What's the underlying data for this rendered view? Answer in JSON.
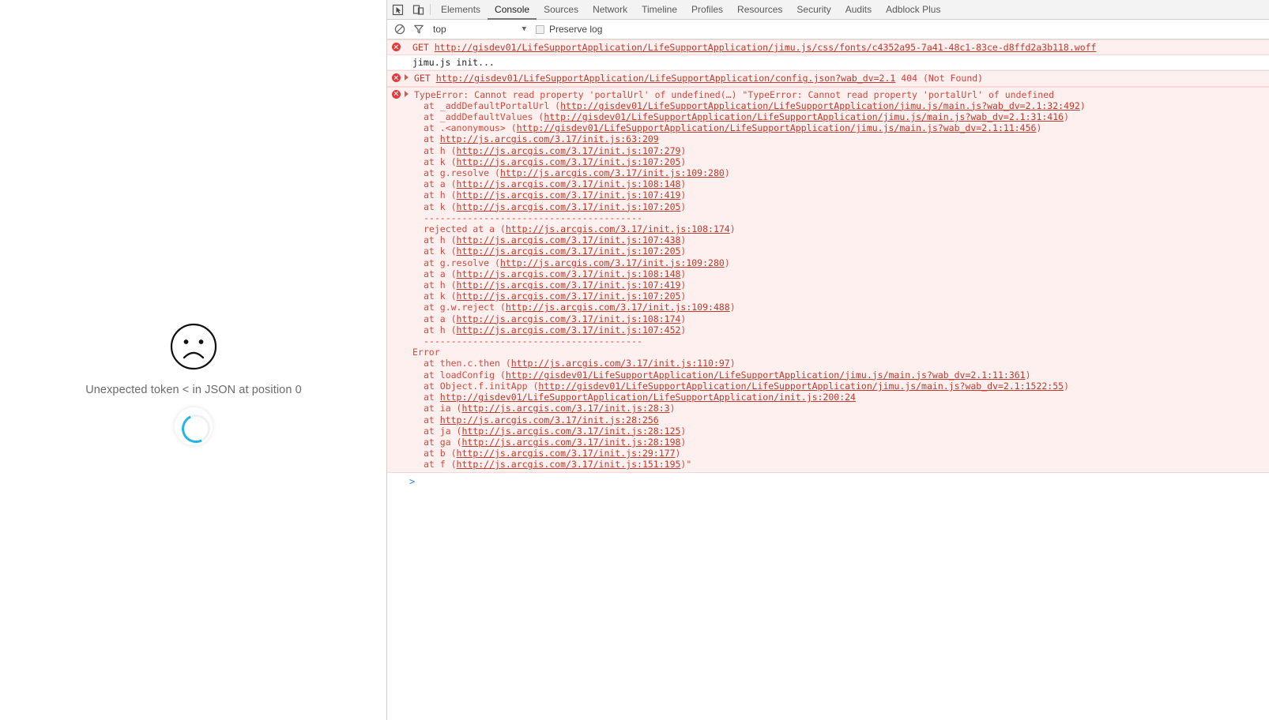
{
  "page": {
    "error_message": "Unexpected token < in JSON at position 0",
    "sad_face_icon": "sad-face-icon",
    "spinner_icon": "loading-spinner",
    "spinner_color": "#1fb6e8"
  },
  "devtools": {
    "toolbar": {
      "inspect_icon": "inspect-element-icon",
      "device_icon": "device-toolbar-icon"
    },
    "tabs": [
      {
        "label": "Elements",
        "active": false
      },
      {
        "label": "Console",
        "active": true
      },
      {
        "label": "Sources",
        "active": false
      },
      {
        "label": "Network",
        "active": false
      },
      {
        "label": "Timeline",
        "active": false
      },
      {
        "label": "Profiles",
        "active": false
      },
      {
        "label": "Resources",
        "active": false
      },
      {
        "label": "Security",
        "active": false
      },
      {
        "label": "Audits",
        "active": false
      },
      {
        "label": "Adblock Plus",
        "active": false
      }
    ],
    "filterbar": {
      "clear_icon": "clear-console-icon",
      "filter_icon": "filter-funnel-icon",
      "context": "top",
      "caret": "▼",
      "preserve_log_label": "Preserve log",
      "preserve_log_checked": false
    },
    "messages": [
      {
        "id": "msg-font-404",
        "type": "error",
        "expandable": false,
        "verb": "GET",
        "url": "http://gisdev01/LifeSupportApplication/LifeSupportApplication/jimu.js/css/fonts/c4352a95-7a41-48c1-83ce-d8ffd2a3b118.woff",
        "status": ""
      },
      {
        "id": "msg-jimu-init",
        "type": "log",
        "text": "jimu.js init..."
      },
      {
        "id": "msg-config-404",
        "type": "error",
        "expandable": true,
        "verb": "GET",
        "url": "http://gisdev01/LifeSupportApplication/LifeSupportApplication/config.json?wab_dv=2.1",
        "status": "404 (Not Found)"
      },
      {
        "id": "msg-typeerror",
        "type": "error-block",
        "expandable": true,
        "header": "TypeError: Cannot read property 'portalUrl' of undefined(…) \"TypeError: Cannot read property 'portalUrl' of undefined",
        "lines": [
          {
            "prefix": "at _addDefaultPortalUrl (",
            "link": "http://gisdev01/LifeSupportApplication/LifeSupportApplication/jimu.js/main.js?wab_dv=2.1:32:492",
            "suffix": ")"
          },
          {
            "prefix": "at _addDefaultValues (",
            "link": "http://gisdev01/LifeSupportApplication/LifeSupportApplication/jimu.js/main.js?wab_dv=2.1:31:416",
            "suffix": ")"
          },
          {
            "prefix": "at .<anonymous> (",
            "link": "http://gisdev01/LifeSupportApplication/LifeSupportApplication/jimu.js/main.js?wab_dv=2.1:11:456",
            "suffix": ")"
          },
          {
            "prefix": "at ",
            "link": "http://js.arcgis.com/3.17/init.js:63:209",
            "suffix": ""
          },
          {
            "prefix": "at h (",
            "link": "http://js.arcgis.com/3.17/init.js:107:279",
            "suffix": ")"
          },
          {
            "prefix": "at k (",
            "link": "http://js.arcgis.com/3.17/init.js:107:205",
            "suffix": ")"
          },
          {
            "prefix": "at g.resolve (",
            "link": "http://js.arcgis.com/3.17/init.js:109:280",
            "suffix": ")"
          },
          {
            "prefix": "at a (",
            "link": "http://js.arcgis.com/3.17/init.js:108:148",
            "suffix": ")"
          },
          {
            "prefix": "at h (",
            "link": "http://js.arcgis.com/3.17/init.js:107:419",
            "suffix": ")"
          },
          {
            "prefix": "at k (",
            "link": "http://js.arcgis.com/3.17/init.js:107:205",
            "suffix": ")"
          },
          {
            "prefix": "----------------------------------------",
            "link": "",
            "suffix": ""
          },
          {
            "prefix": "rejected at a (",
            "link": "http://js.arcgis.com/3.17/init.js:108:174",
            "suffix": ")"
          },
          {
            "prefix": "at h (",
            "link": "http://js.arcgis.com/3.17/init.js:107:438",
            "suffix": ")"
          },
          {
            "prefix": "at k (",
            "link": "http://js.arcgis.com/3.17/init.js:107:205",
            "suffix": ")"
          },
          {
            "prefix": "at g.resolve (",
            "link": "http://js.arcgis.com/3.17/init.js:109:280",
            "suffix": ")"
          },
          {
            "prefix": "at a (",
            "link": "http://js.arcgis.com/3.17/init.js:108:148",
            "suffix": ")"
          },
          {
            "prefix": "at h (",
            "link": "http://js.arcgis.com/3.17/init.js:107:419",
            "suffix": ")"
          },
          {
            "prefix": "at k (",
            "link": "http://js.arcgis.com/3.17/init.js:107:205",
            "suffix": ")"
          },
          {
            "prefix": "at g.w.reject (",
            "link": "http://js.arcgis.com/3.17/init.js:109:488",
            "suffix": ")"
          },
          {
            "prefix": "at a (",
            "link": "http://js.arcgis.com/3.17/init.js:108:174",
            "suffix": ")"
          },
          {
            "prefix": "at h (",
            "link": "http://js.arcgis.com/3.17/init.js:107:452",
            "suffix": ")"
          },
          {
            "prefix": "----------------------------------------",
            "link": "",
            "suffix": ""
          }
        ],
        "second_header": "Error",
        "second_lines": [
          {
            "prefix": "at then.c.then (",
            "link": "http://js.arcgis.com/3.17/init.js:110:97",
            "suffix": ")"
          },
          {
            "prefix": "at loadConfig (",
            "link": "http://gisdev01/LifeSupportApplication/LifeSupportApplication/jimu.js/main.js?wab_dv=2.1:11:361",
            "suffix": ")"
          },
          {
            "prefix": "at Object.f.initApp (",
            "link": "http://gisdev01/LifeSupportApplication/LifeSupportApplication/jimu.js/main.js?wab_dv=2.1:1522:55",
            "suffix": ")"
          },
          {
            "prefix": "at ",
            "link": "http://gisdev01/LifeSupportApplication/LifeSupportApplication/init.js:200:24",
            "suffix": ""
          },
          {
            "prefix": "at ia (",
            "link": "http://js.arcgis.com/3.17/init.js:28:3",
            "suffix": ")"
          },
          {
            "prefix": "at ",
            "link": "http://js.arcgis.com/3.17/init.js:28:256",
            "suffix": ""
          },
          {
            "prefix": "at ja (",
            "link": "http://js.arcgis.com/3.17/init.js:28:125",
            "suffix": ")"
          },
          {
            "prefix": "at ga (",
            "link": "http://js.arcgis.com/3.17/init.js:28:198",
            "suffix": ")"
          },
          {
            "prefix": "at b (",
            "link": "http://js.arcgis.com/3.17/init.js:29:177",
            "suffix": ")"
          },
          {
            "prefix": "at f (",
            "link": "http://js.arcgis.com/3.17/init.js:151:195",
            "suffix": ")\""
          }
        ]
      }
    ],
    "prompt_chevron": ">"
  }
}
